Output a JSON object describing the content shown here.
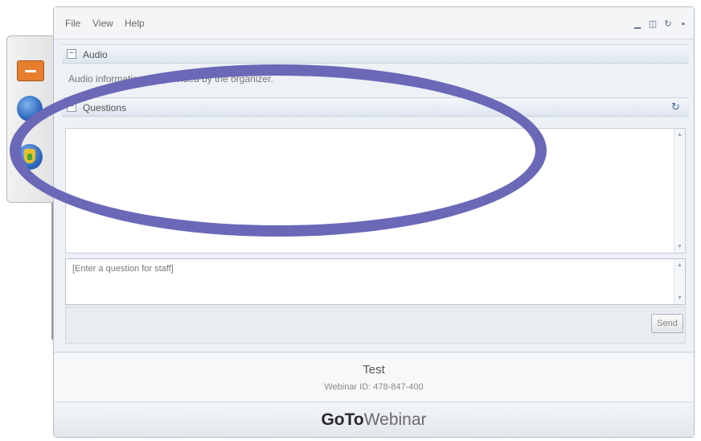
{
  "menu": {
    "file": "File",
    "view": "View",
    "help": "Help"
  },
  "window_controls": {
    "minimize": "▁",
    "restore": "◫",
    "settings": "↻",
    "close": "▪"
  },
  "audio": {
    "header": "Audio",
    "toggle": "−",
    "message": "Audio information not provided by the organizer."
  },
  "questions": {
    "header": "Questions",
    "toggle": "−",
    "input_placeholder": "[Enter a question for staff]",
    "send_label": "Send"
  },
  "webinar": {
    "title": "Test",
    "id_line": "Webinar ID: 478-847-400"
  },
  "brand": {
    "goto": "GoTo",
    "webinar": "Webinar"
  },
  "colors": {
    "annotation": "#6b68b8",
    "hide_button": "#e67e2e",
    "accent_blue": "#2e68bd"
  }
}
